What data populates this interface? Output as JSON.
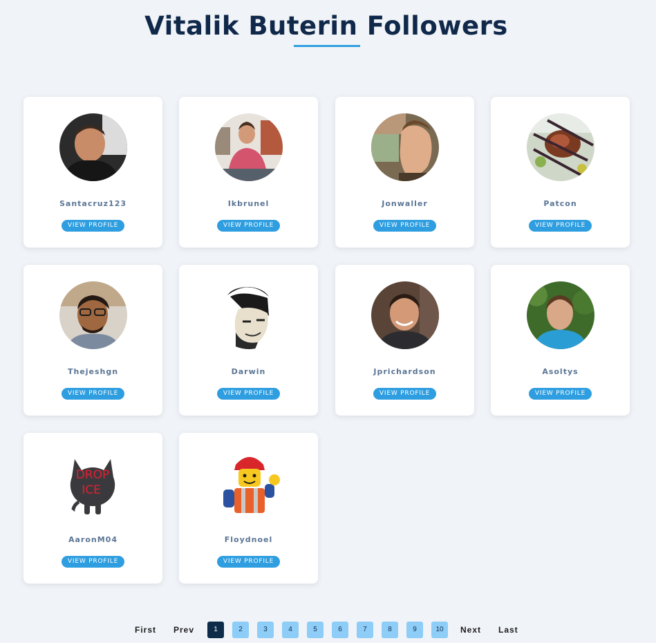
{
  "header": {
    "title": "Vitalik Buterin Followers"
  },
  "cards": [
    {
      "username": "Santacruz123",
      "button": "VIEW PROFILE",
      "avatar": "man-dark-shirt-avatar"
    },
    {
      "username": "Ikbrunel",
      "button": "VIEW PROFILE",
      "avatar": "man-pink-shirt-avatar"
    },
    {
      "username": "Jonwaller",
      "button": "VIEW PROFILE",
      "avatar": "man-profile-avatar"
    },
    {
      "username": "Patcon",
      "button": "VIEW PROFILE",
      "avatar": "food-grill-avatar"
    },
    {
      "username": "Thejeshgn",
      "button": "VIEW PROFILE",
      "avatar": "man-glasses-avatar"
    },
    {
      "username": "Darwin",
      "button": "VIEW PROFILE",
      "avatar": "sketch-portrait-avatar"
    },
    {
      "username": "Jprichardson",
      "button": "VIEW PROFILE",
      "avatar": "man-smiling-avatar"
    },
    {
      "username": "Asoltys",
      "button": "VIEW PROFILE",
      "avatar": "man-blue-shirt-avatar"
    },
    {
      "username": "AaronM04",
      "button": "VIEW PROFILE",
      "avatar": "octocat-drop-ice-avatar",
      "avatar_text": [
        "DROP",
        "ICE"
      ]
    },
    {
      "username": "Floydnoel",
      "button": "VIEW PROFILE",
      "avatar": "lego-builder-avatar"
    }
  ],
  "pagination": {
    "first": "First",
    "prev": "Prev",
    "pages": [
      "1",
      "2",
      "3",
      "4",
      "5",
      "6",
      "7",
      "8",
      "9",
      "10"
    ],
    "current_page": "1",
    "next": "Next",
    "last": "Last"
  },
  "colors": {
    "accent": "#2e9ee0",
    "title": "#10294a",
    "active_page": "#0e2c4a",
    "page_button": "#8ecdf7"
  }
}
